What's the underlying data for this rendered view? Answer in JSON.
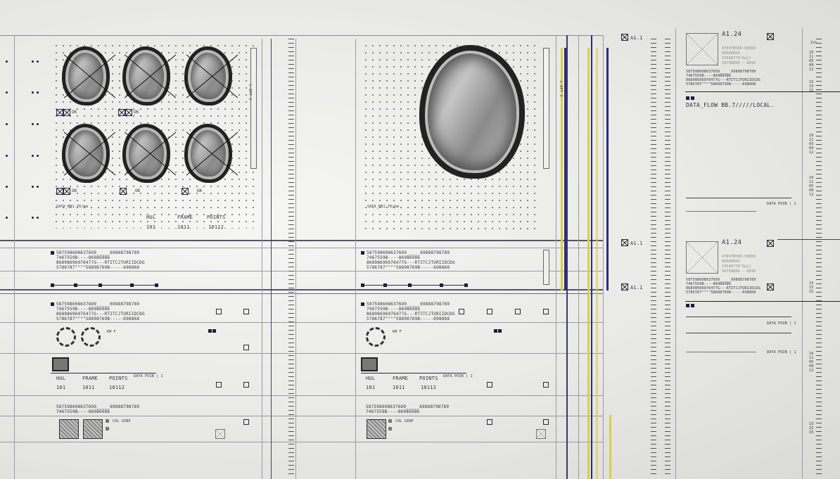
{
  "left_panel": {
    "ok_labels": [
      "OK",
      "OK",
      "OK",
      "OK",
      "OK",
      "OK"
    ],
    "data_label": "SATA_BB1.76/mm",
    "stats_labels": [
      "HUL",
      "FRAME",
      "POINTS"
    ],
    "stats_values": [
      "101",
      "1011",
      "10112"
    ],
    "scroll_label": "L-DPT 3"
  },
  "center_panel": {
    "data_label": "SATA_BB1.76/mm",
    "scroll_label": "L-DPT 3"
  },
  "text_blocks": {
    "block_a": [
      "5875986086376O9_____69888798789",
      "7467559B----86986986",
      "86898696976477G---RTITCJTURIIDCDG",
      "5786787\"\"\"\"58898769B-----698868"
    ],
    "block_b": [
      "5875986086376O9_____69888798789",
      "7467559B----86986986",
      "86898696976477G---RTITCJTURIIDCDG",
      "5786787\"\"\"\"58898769B-----698868"
    ],
    "block_c": [
      "5875986086376O9_____69888798789",
      "7467559B----86986986"
    ]
  },
  "lower_widgets": {
    "stats_labels": [
      "HUL",
      "FRAME",
      "POINTS"
    ],
    "stats_values": [
      "101",
      "1011",
      "10112"
    ],
    "data_point": "DATA POIN | 1",
    "label_small": "KM F",
    "col_label": "COL GINP"
  },
  "right_panel": {
    "tag_a": "A1.1",
    "tag_b": "A1.1",
    "tag_c": "A1.1",
    "card1_title": "A1.24",
    "card2_title": "A1.24",
    "card_lines": [
      "47897B589-58989",
      "98586B59",
      "53598770\"8q]]",
      "58798B89---6890"
    ],
    "card_block": [
      "5875986086376O9_____69888798789",
      "7467559B----86986986",
      "86898696976477G---RTITCJTURIIDCDG",
      "5786787\"\"\"\"58898769B-----698868"
    ],
    "data_flow": "DATA_FLOW BB.7/////LOCAL.",
    "data_point": "DATA POIN | 1"
  },
  "far_right": {
    "header": "Int",
    "numbers": [
      "10",
      "11",
      "05",
      "09",
      "12",
      "15",
      "15",
      "15"
    ]
  },
  "colors": {
    "accent": "#d8cf4a",
    "navy": "#2c2c7a",
    "ink": "#23232e"
  }
}
